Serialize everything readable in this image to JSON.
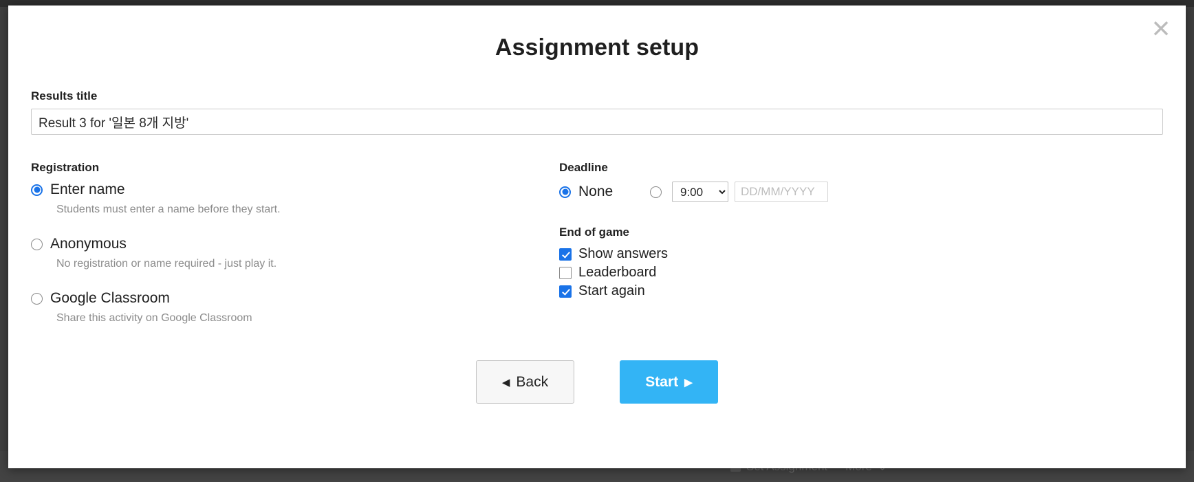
{
  "background": {
    "taskbar_items": [
      {
        "label": "Set Assignment",
        "icon": "checkbox-icon"
      },
      {
        "label": "More",
        "icon": "chevron-down-icon"
      }
    ]
  },
  "dialog": {
    "title": "Assignment setup",
    "close_icon": "close-icon",
    "results_title": {
      "label": "Results title",
      "value": "Result 3 for '일본 8개 지방'"
    },
    "registration": {
      "heading": "Registration",
      "options": [
        {
          "label": "Enter name",
          "helper": "Students must enter a name before they start.",
          "checked": true
        },
        {
          "label": "Anonymous",
          "helper": "No registration or name required - just play it.",
          "checked": false
        },
        {
          "label": "Google Classroom",
          "helper": "Share this activity on Google Classroom",
          "checked": false
        }
      ]
    },
    "deadline": {
      "heading": "Deadline",
      "none_label": "None",
      "none_checked": true,
      "custom_checked": false,
      "time_value": "9:00",
      "time_options": [
        "9:00"
      ],
      "date_placeholder": "DD/MM/YYYY",
      "date_value": ""
    },
    "end_of_game": {
      "heading": "End of game",
      "options": [
        {
          "label": "Show answers",
          "checked": true
        },
        {
          "label": "Leaderboard",
          "checked": false
        },
        {
          "label": "Start again",
          "checked": true
        }
      ]
    },
    "footer": {
      "back_label": "Back",
      "back_arrow": "◀",
      "start_label": "Start",
      "start_arrow": "▶"
    }
  },
  "colors": {
    "accent_blue": "#33b4f5",
    "control_blue": "#1a73e8",
    "overlay": "#3f3f3f"
  }
}
